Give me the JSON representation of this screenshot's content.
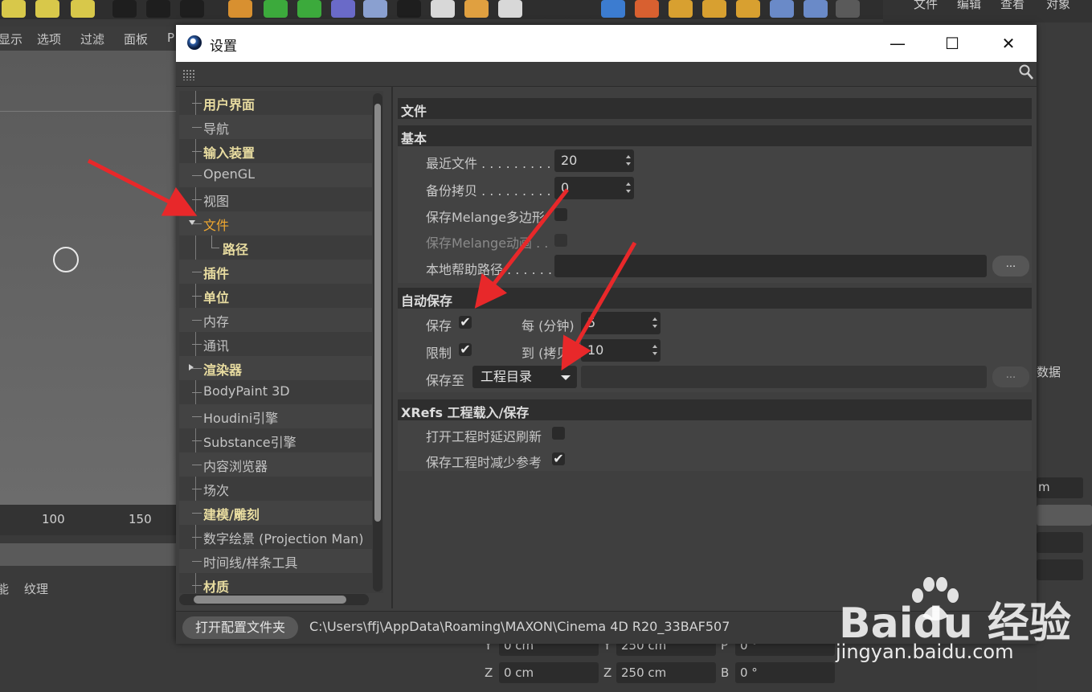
{
  "app_menu": {
    "left_items": [
      "显示",
      "选项",
      "过滤",
      "面板",
      "P"
    ],
    "right_items": [
      "文件",
      "编辑",
      "查看",
      "对象"
    ]
  },
  "timeline": {
    "ticks": [
      "100",
      "150"
    ]
  },
  "bottom_tabs": [
    "能",
    "纹理"
  ],
  "right_panel": {
    "label_fragment": "数据",
    "unit_fragment": "m"
  },
  "coords": {
    "row1": {
      "lbl1": "Y",
      "val1": "0 cm",
      "lbl2": "Y",
      "val2": "250 cm",
      "lbl3": "P",
      "val3": "0 °"
    },
    "row2": {
      "lbl1": "Z",
      "val1": "0 cm",
      "lbl2": "Z",
      "val2": "250 cm",
      "lbl3": "B",
      "val3": "0 °"
    }
  },
  "dialog": {
    "title": "设置",
    "minimize": "—",
    "maximize": "☐",
    "close": "✕"
  },
  "tree": [
    {
      "label": "用户界面",
      "style": "bold",
      "expander": false
    },
    {
      "label": "导航",
      "style": "normal",
      "expander": false
    },
    {
      "label": "输入装置",
      "style": "bold",
      "expander": false
    },
    {
      "label": "OpenGL",
      "style": "normal",
      "expander": false
    },
    {
      "label": "视图",
      "style": "normal",
      "expander": false
    },
    {
      "label": "文件",
      "style": "active",
      "expander": "open"
    },
    {
      "label": "路径",
      "style": "bold",
      "expander": false,
      "child": true
    },
    {
      "label": "插件",
      "style": "bold",
      "expander": false
    },
    {
      "label": "单位",
      "style": "bold",
      "expander": false
    },
    {
      "label": "内存",
      "style": "normal",
      "expander": false
    },
    {
      "label": "通讯",
      "style": "normal",
      "expander": false
    },
    {
      "label": "渲染器",
      "style": "bold",
      "expander": "closed"
    },
    {
      "label": "BodyPaint 3D",
      "style": "normal",
      "expander": false
    },
    {
      "label": "Houdini引擎",
      "style": "normal",
      "expander": false
    },
    {
      "label": "Substance引擎",
      "style": "normal",
      "expander": false
    },
    {
      "label": "内容浏览器",
      "style": "normal",
      "expander": false
    },
    {
      "label": "场次",
      "style": "normal",
      "expander": false
    },
    {
      "label": "建模/雕刻",
      "style": "bold",
      "expander": false
    },
    {
      "label": "数字绘景 (Projection Man)",
      "style": "normal",
      "expander": false
    },
    {
      "label": "时间线/样条工具",
      "style": "normal",
      "expander": false
    },
    {
      "label": "材质",
      "style": "bold",
      "expander": false
    }
  ],
  "settings": {
    "header": "文件",
    "basic": {
      "title": "基本",
      "recent_files_label": "最近文件 . . . . . . . . . .",
      "recent_files_value": "20",
      "backup_label": "备份拷贝 . . . . . . . . . .",
      "backup_value": "0",
      "melange_poly_label": "保存Melange多边形",
      "melange_anim_label": "保存Melange动画 . .",
      "help_path_label": "本地帮助路径 . . . . . . .",
      "help_path_value": "",
      "browse": "..."
    },
    "autosave": {
      "title": "自动保存",
      "save_label": "保存",
      "save_checked": "✔",
      "every_label": "每 (分钟)",
      "every_value": "5",
      "limit_label": "限制",
      "limit_checked": "✔",
      "to_label": "到 (拷贝)",
      "to_value": "10",
      "save_to_label": "保存至",
      "save_to_value": "工程目录",
      "path_value": "",
      "browse": "..."
    },
    "xrefs": {
      "title": "XRefs 工程载入/保存",
      "delay_refresh_label": "打开工程时延迟刷新",
      "reduce_refs_label": "保存工程时减少参考",
      "reduce_refs_checked": "✔"
    }
  },
  "footer": {
    "open_folder": "打开配置文件夹",
    "path": "C:\\Users\\ffj\\AppData\\Roaming\\MAXON\\Cinema 4D R20_33BAF507"
  },
  "watermark": {
    "brand": "Baidu 经验",
    "url": "jingyan.baidu.com"
  },
  "colors": {
    "active": "#f0a830",
    "bold_label": "#e8dca0",
    "arrow": "#e8282a"
  }
}
